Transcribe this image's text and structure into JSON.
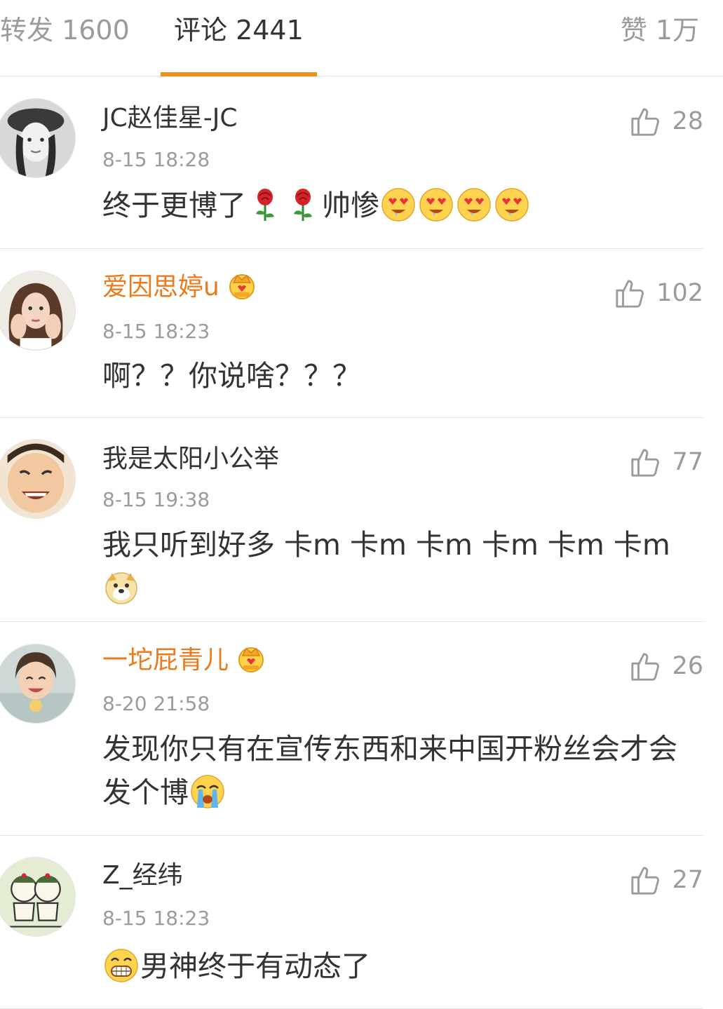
{
  "tabs": {
    "reposts": "转发 1600",
    "comments": "评论 2441",
    "likes": "赞 1万",
    "accent_color": "#f28c1c"
  },
  "comments": [
    {
      "username": "JC赵佳星-JC",
      "vip": false,
      "time": "8-15 18:28",
      "likes": "28",
      "text_before": "终于更博了",
      "text_after": "帅惨",
      "emojis_mid": [
        "rose-emoji",
        "rose-emoji"
      ],
      "emojis_end": [
        "heart-eyes-emoji",
        "heart-eyes-emoji",
        "heart-eyes-emoji",
        "heart-eyes-emoji"
      ]
    },
    {
      "username": "爱因思婷u",
      "vip": true,
      "time": "8-15 18:23",
      "likes": "102",
      "text": "啊？？你说啥？？？"
    },
    {
      "username": "我是太阳小公举",
      "vip": false,
      "time": "8-15 19:38",
      "likes": "77",
      "text": "我只听到好多 卡m 卡m 卡m 卡m 卡m 卡m",
      "emojis_end": [
        "doge-emoji"
      ]
    },
    {
      "username": "一坨屁青儿",
      "vip": true,
      "time": "8-20 21:58",
      "likes": "26",
      "text": "发现你只有在宣传东西和来中国开粉丝会才会发个博",
      "emojis_end": [
        "crying-emoji"
      ]
    },
    {
      "username": "Z_经纬",
      "vip": false,
      "time": "8-15 18:23",
      "likes": "27",
      "text": "男神终于有动态了",
      "emojis_start": [
        "grin-emoji"
      ]
    }
  ],
  "colors": {
    "vip_name": "#eb7a1d",
    "meta_gray": "#9b9b9b",
    "divider": "#e3e3e3"
  }
}
